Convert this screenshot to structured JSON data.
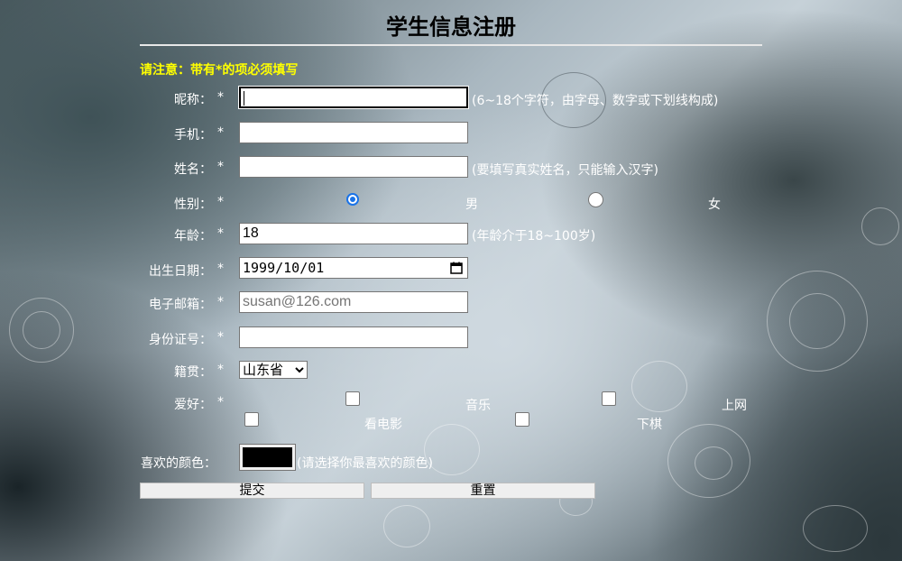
{
  "title": "学生信息注册",
  "notice": "请注意：带有*的项必须填写",
  "required_mark": "*",
  "fields": {
    "nickname": {
      "label": "昵称：",
      "value": "",
      "hint": "(6~18个字符，由字母、数字或下划线构成)"
    },
    "phone": {
      "label": "手机：",
      "value": ""
    },
    "name": {
      "label": "姓名：",
      "value": "",
      "hint": "(要填写真实姓名，只能输入汉字)"
    },
    "gender": {
      "label": "性别：",
      "options": [
        "男",
        "女"
      ],
      "selected": "男"
    },
    "age": {
      "label": "年龄：",
      "value": "18",
      "hint": "(年龄介于18~100岁)"
    },
    "birthdate": {
      "label": "出生日期：",
      "value": "1999/10/01"
    },
    "email": {
      "label": "电子邮箱：",
      "placeholder": "susan@126.com"
    },
    "id_number": {
      "label": "身份证号：",
      "value": ""
    },
    "hometown": {
      "label": "籍贯：",
      "selected": "山东省"
    },
    "hobbies": {
      "label": "爱好：",
      "options": [
        "看电影",
        "音乐",
        "上网",
        "下棋"
      ],
      "checked": []
    },
    "color": {
      "label": "喜欢的颜色：",
      "value": "#000000",
      "hint": "(请选择你最喜欢的颜色)"
    }
  },
  "buttons": {
    "submit": "提交",
    "reset": "重置"
  },
  "colors": {
    "notice": "#ffff00",
    "radio_accent": "#1a73e8",
    "label_text": "#ffffff"
  }
}
